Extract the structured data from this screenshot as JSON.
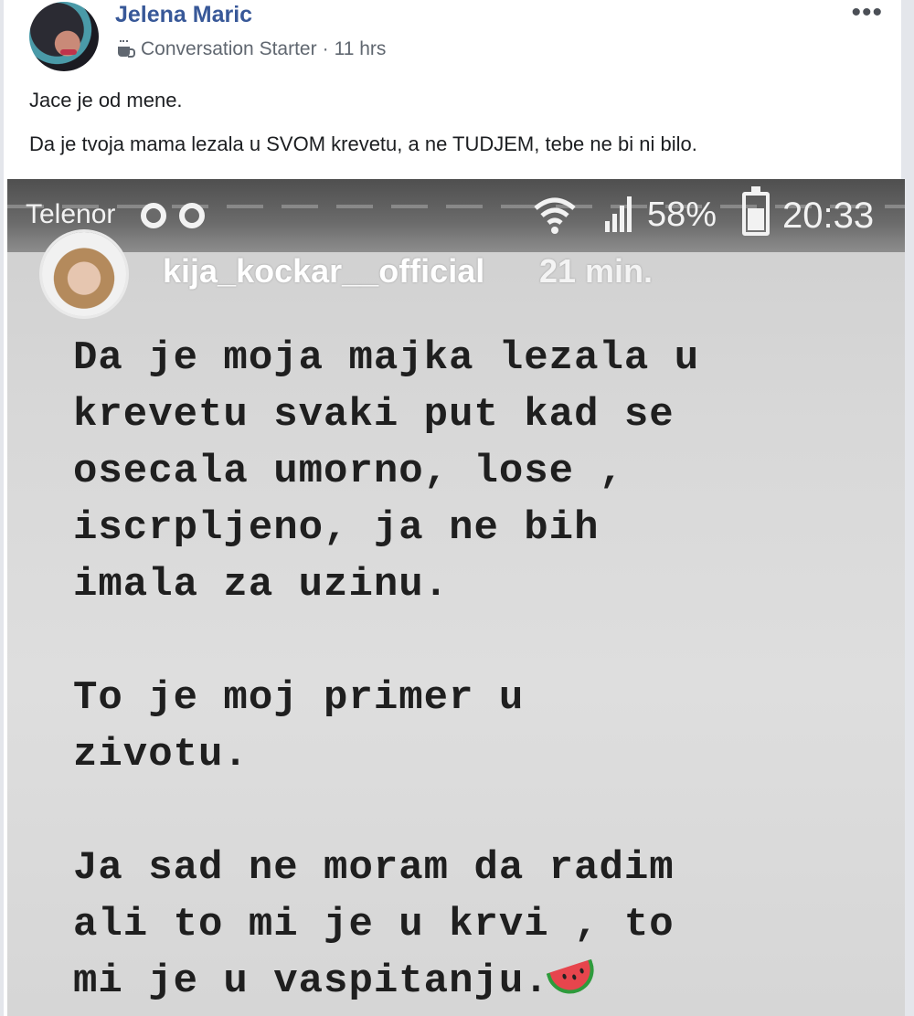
{
  "post": {
    "author": "Jelena Maric",
    "badge": "Conversation Starter",
    "separator": "·",
    "time": "11 hrs",
    "more": "•••",
    "paragraphs": [
      "Jace je od mene.",
      "Da je tvoja mama lezala u SVOM krevetu, a ne TUDJEM, tebe ne bi ni bilo."
    ]
  },
  "story": {
    "status_bar": {
      "carrier": "Telenor",
      "battery": "58%",
      "clock": "20:33"
    },
    "username": "kija_kockar__official",
    "time": "21 min.",
    "paragraphs": [
      [
        "Da je moja majka lezala u",
        "krevetu svaki put kad se",
        "osecala umorno, lose ,",
        "iscrpljeno, ja ne bih",
        "imala za uzinu."
      ],
      [
        "To je moj primer u",
        "zivotu."
      ],
      [
        "Ja sad ne moram da radim",
        "ali to mi je u krvi , to",
        "mi je u vaspitanju."
      ]
    ]
  },
  "icons": {
    "badge": "coffee-cup-icon",
    "more": "more-options-icon",
    "emoji": "watermelon-icon"
  }
}
